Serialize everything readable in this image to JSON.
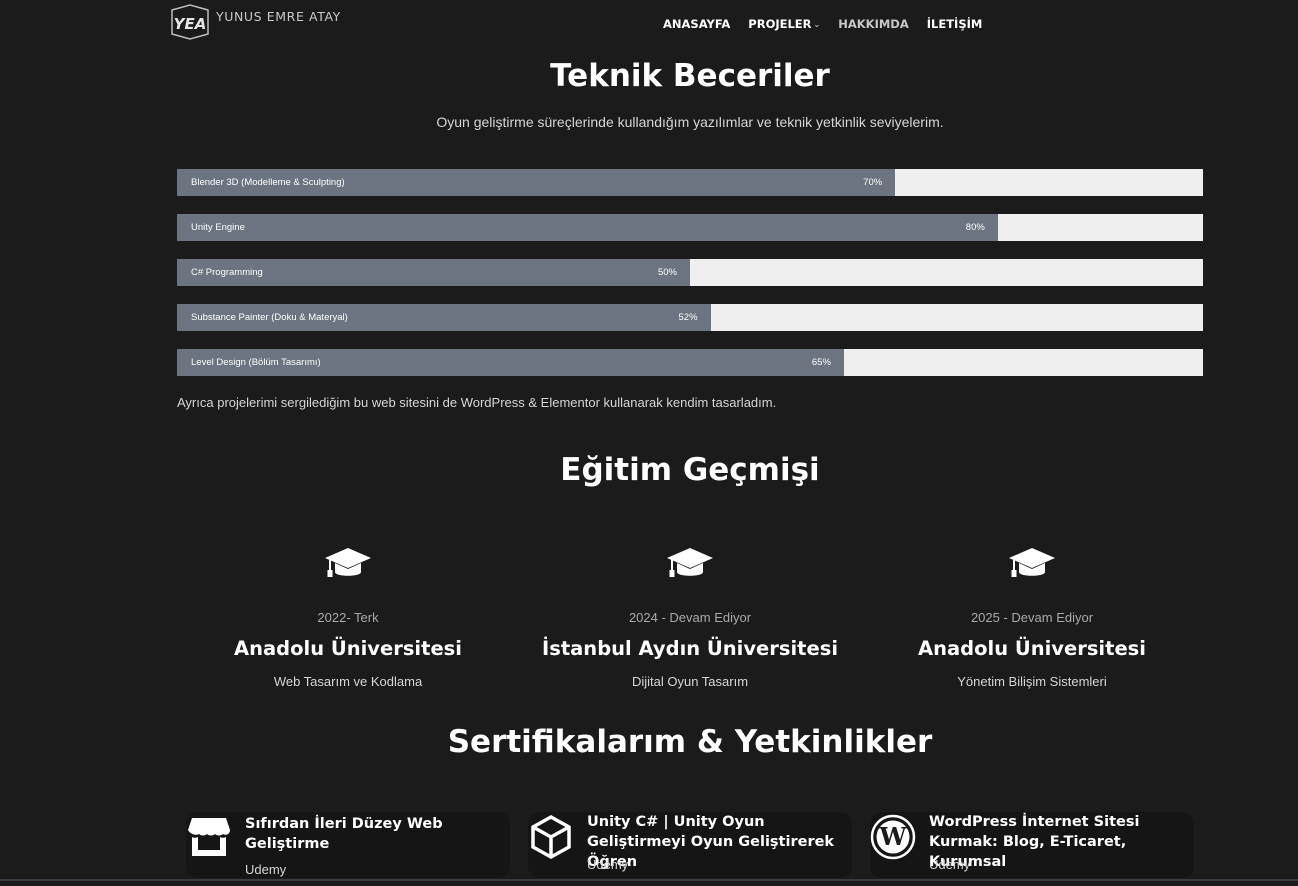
{
  "header": {
    "logo_text": "YUNUS EMRE ATAY",
    "nav": {
      "home": "ANASAYFA",
      "projects": "PROJELER",
      "about": "HAKKIMDA",
      "contact": "İLETİŞİM"
    }
  },
  "skills": {
    "title": "Teknik Beceriler",
    "subtitle": "Oyun geliştirme süreçlerinde kullandığım yazılımlar ve teknik yetkinlik seviyelerim.",
    "items": [
      {
        "label": "Blender 3D (Modelleme & Sculpting)",
        "percent": 70,
        "percent_label": "70%"
      },
      {
        "label": "Unity Engine",
        "percent": 80,
        "percent_label": "80%"
      },
      {
        "label": "C# Programming",
        "percent": 50,
        "percent_label": "50%"
      },
      {
        "label": "Substance Painter (Doku & Materyal)",
        "percent": 52,
        "percent_label": "52%"
      },
      {
        "label": "Level Design (Bölüm Tasarımı)",
        "percent": 65,
        "percent_label": "65%"
      }
    ],
    "note": "Ayrıca projelerimi sergilediğim bu web sitesini de WordPress & Elementor kullanarak kendim tasarladım."
  },
  "education": {
    "title": "Eğitim Geçmişi",
    "items": [
      {
        "icon": "graduation-cap-icon",
        "year": "2022- Terk",
        "school": "Anadolu Üniversitesi",
        "department": "Web Tasarım ve Kodlama"
      },
      {
        "icon": "graduation-cap-icon",
        "year": "2024 - Devam Ediyor",
        "school": "İstanbul Aydın Üniversitesi",
        "department": "Dijital Oyun Tasarım"
      },
      {
        "icon": "graduation-cap-icon",
        "year": "2025 - Devam Ediyor",
        "school": "Anadolu Üniversitesi",
        "department": "Yönetim Bilişim Sistemleri"
      }
    ]
  },
  "certificates": {
    "title": "Sertifikalarım & Yetkinlikler",
    "items": [
      {
        "icon": "store-icon",
        "name": "Sıfırdan İleri Düzey Web Geliştirme",
        "source": "Udemy"
      },
      {
        "icon": "unity-icon",
        "name": "Unity C# | Unity Oyun Geliştirmeyi Oyun Geliştirerek Öğren",
        "source": "Udemy"
      },
      {
        "icon": "wordpress-icon",
        "name": "WordPress İnternet Sitesi Kurmak: Blog, E-Ticaret, Kurumsal",
        "source": "Udemy"
      }
    ]
  },
  "colors": {
    "background": "#1b1b1c",
    "bar_fill": "#6b7480",
    "bar_track": "#efefef",
    "text": "#ffffff"
  }
}
